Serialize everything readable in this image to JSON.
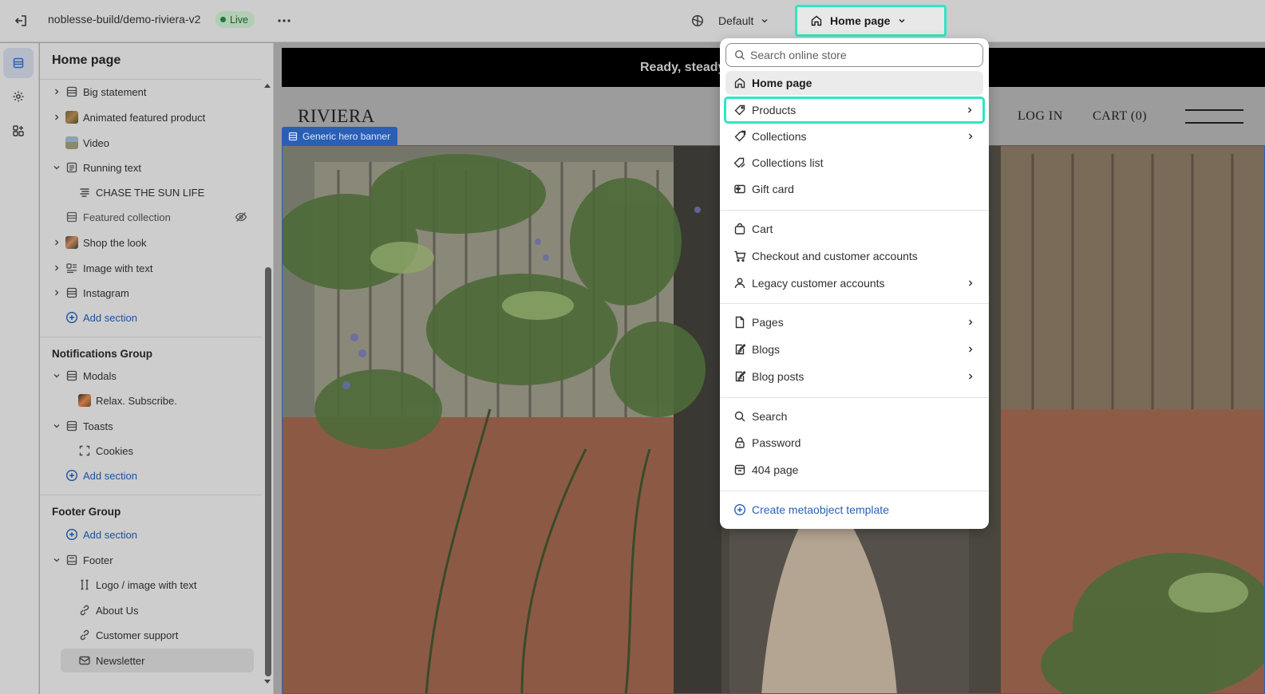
{
  "topbar": {
    "store_name": "noblesse-build/demo-riviera-v2",
    "status": "Live",
    "theme_selector": "Default",
    "page_selector": "Home page"
  },
  "sidebar": {
    "title": "Home page",
    "template_items": [
      {
        "label": "Big statement"
      },
      {
        "label": "Animated featured product"
      },
      {
        "label": "Video"
      },
      {
        "label": "Running text"
      },
      {
        "label": "CHASE THE SUN LIFE"
      },
      {
        "label": "Featured collection"
      },
      {
        "label": "Shop the look"
      },
      {
        "label": "Image with text"
      },
      {
        "label": "Instagram"
      }
    ],
    "add_section": "Add section",
    "notifications_group": {
      "title": "Notifications Group",
      "items": [
        {
          "label": "Modals"
        },
        {
          "label": "Relax. Subscribe."
        },
        {
          "label": "Toasts"
        },
        {
          "label": "Cookies"
        }
      ],
      "add_section": "Add section"
    },
    "footer_group": {
      "title": "Footer Group",
      "add_section": "Add section",
      "items": [
        {
          "label": "Footer"
        },
        {
          "label": "Logo / image with text"
        },
        {
          "label": "About Us"
        },
        {
          "label": "Customer support"
        },
        {
          "label": "Newsletter"
        }
      ]
    }
  },
  "preview": {
    "announcement": "Ready, steady",
    "logo": "RIVIERA",
    "nav_login": "LOG IN",
    "nav_cart": "CART (0)",
    "section_tag": "Generic hero banner"
  },
  "dropdown": {
    "search_placeholder": "Search online store",
    "items": [
      {
        "label": "Home page",
        "icon": "home-icon"
      },
      {
        "label": "Products",
        "icon": "tag-icon"
      },
      {
        "label": "Collections",
        "icon": "collection-tag-icon"
      },
      {
        "label": "Collections list",
        "icon": "collections-list-icon"
      },
      {
        "label": "Gift card",
        "icon": "gift-card-icon"
      },
      {
        "label": "Cart",
        "icon": "bag-icon"
      },
      {
        "label": "Checkout and customer accounts",
        "icon": "cart-icon"
      },
      {
        "label": "Legacy customer accounts",
        "icon": "person-icon"
      },
      {
        "label": "Pages",
        "icon": "page-icon"
      },
      {
        "label": "Blogs",
        "icon": "blog-icon"
      },
      {
        "label": "Blog posts",
        "icon": "blog-post-icon"
      },
      {
        "label": "Search",
        "icon": "search-icon"
      },
      {
        "label": "Password",
        "icon": "lock-icon"
      },
      {
        "label": "404 page",
        "icon": "error-page-icon"
      },
      {
        "label": "Create metaobject template",
        "icon": "plus-circle-icon"
      }
    ]
  },
  "colors": {
    "highlight": "#2ee6c2",
    "accent_blue": "#2b5fb6",
    "live_badge": "#b2cdb3"
  }
}
